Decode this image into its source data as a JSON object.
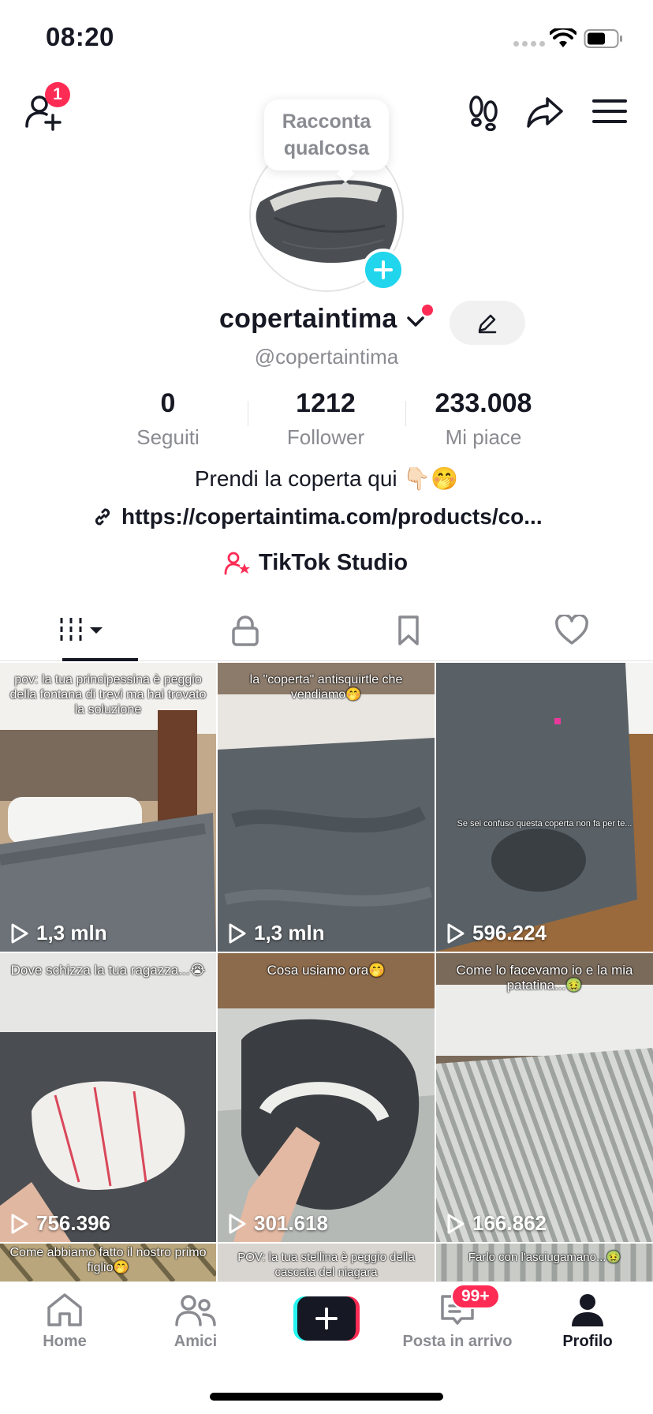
{
  "status_bar": {
    "time": "08:20"
  },
  "header": {
    "notification_count": "1"
  },
  "avatar": {
    "tooltip": "Racconta qualcosa"
  },
  "profile": {
    "display_name": "copertaintima",
    "handle": "@copertaintima",
    "bio": "Prendi la coperta qui 👇🏻🤭",
    "link": "https://copertaintima.com/products/co...",
    "studio_label": "TikTok Studio"
  },
  "stats": [
    {
      "value": "0",
      "label": "Seguiti"
    },
    {
      "value": "1212",
      "label": "Follower"
    },
    {
      "value": "233.008",
      "label": "Mi piace"
    }
  ],
  "tabs": [
    {
      "icon": "videos-grid-icon"
    },
    {
      "icon": "lock-icon"
    },
    {
      "icon": "bookmark-icon"
    },
    {
      "icon": "heart-icon"
    }
  ],
  "videos": [
    {
      "caption": "pov: la tua principessina è peggio della fontana di trevi ma hai trovato la soluzione",
      "views": "1,3 mln"
    },
    {
      "caption": "la \"coperta\" antisquirtle che vendiamo🤭",
      "views": "1,3 mln"
    },
    {
      "caption": "Se sei confuso questa coperta non fa per te...",
      "views": "596.224"
    },
    {
      "caption": "Dove schizza la tua ragazza...😭",
      "views": "756.396"
    },
    {
      "caption": "Cosa usiamo ora🤭",
      "views": "301.618"
    },
    {
      "caption": "Come lo facevamo io e la mia patatina...🤢",
      "views": "166.862"
    },
    {
      "caption": "Come abbiamo fatto il nostro primo figlio🤭",
      "views": ""
    },
    {
      "caption": "POV: la tua stellina è peggio della cascata del niagara",
      "views": ""
    },
    {
      "caption": "Farlo con l'asciugamano...🤢",
      "views": ""
    }
  ],
  "bottom_nav": {
    "home": "Home",
    "friends": "Amici",
    "inbox": "Posta in arrivo",
    "inbox_badge": "99+",
    "profile": "Profilo"
  },
  "colors": {
    "accent_red": "#fe2c55",
    "accent_cyan": "#20d5ec",
    "text_primary": "#161823",
    "text_secondary": "#8a8b91"
  }
}
